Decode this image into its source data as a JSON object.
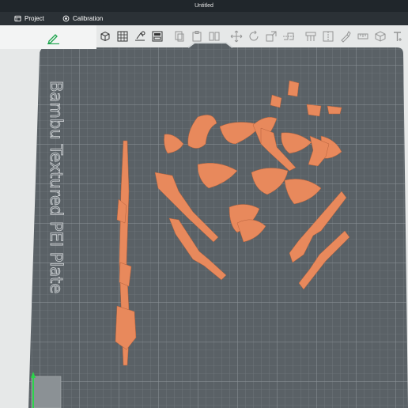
{
  "window": {
    "title": "Untitled"
  },
  "topbar": {
    "tabs": [
      {
        "label": "Project",
        "icon": "project-icon"
      },
      {
        "label": "Calibration",
        "icon": "calibration-icon"
      }
    ]
  },
  "leftpanel": {
    "icon": "edit-icon"
  },
  "toolbar": {
    "tools": [
      "add-cube-icon",
      "grid-icon",
      "auto-orient-icon",
      "arrange-icon",
      "copy-icon",
      "paste-icon",
      "split-icon",
      "move-icon",
      "rotate-icon",
      "scale-icon",
      "cut-icon",
      "support-paint-icon",
      "seam-paint-icon",
      "color-paint-icon",
      "measure-icon",
      "assembly-icon",
      "text-icon"
    ]
  },
  "plate": {
    "label": "Bambu Textured PEI Plate",
    "bed_color": "#5a6166",
    "part_color": "#e8895c"
  }
}
